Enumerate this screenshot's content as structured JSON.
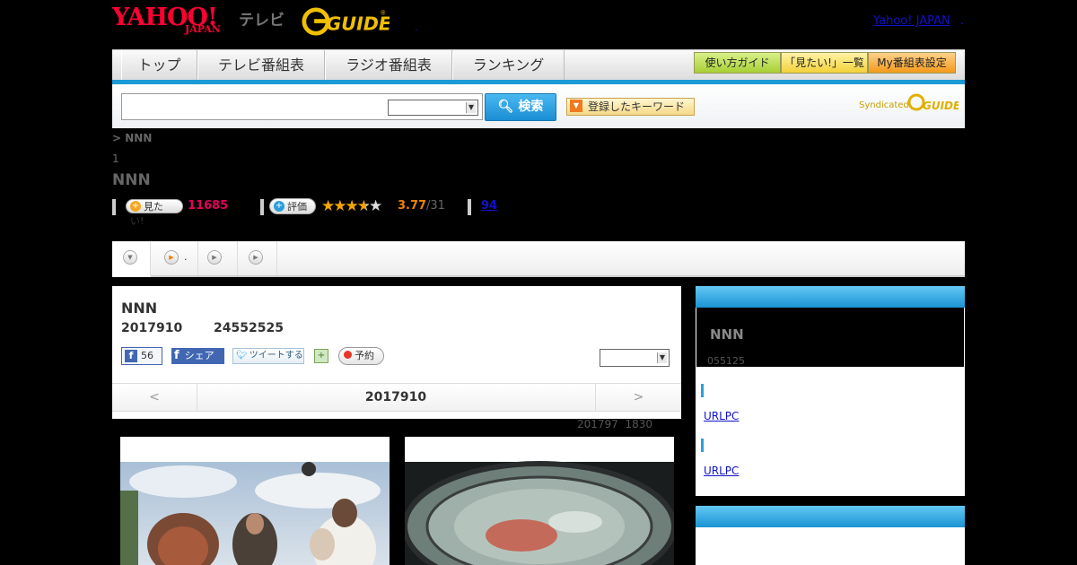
{
  "header": {
    "yahoo": "YAHOO!",
    "japan": "JAPAN",
    "tv": "テレビ",
    "gguide": "G GUIDE",
    "yahoo_japan_link": "Yahoo! JAPAN",
    "dot1": ".",
    "dot2": "."
  },
  "nav": {
    "items": [
      "トップ",
      "テレビ番組表",
      "ラジオ番組表",
      "ランキング"
    ],
    "sub_buttons": [
      "使い方ガイド",
      "「見たい!」一覧",
      "My番組表設定"
    ]
  },
  "search": {
    "button_label": "検索",
    "keyword_button": "登録したキーワード",
    "syndicated": "Syndicated",
    "g_logo": "GUIDE"
  },
  "program": {
    "breadcrumb": "> NNN",
    "ep_num": "1",
    "title": "NNN",
    "want_label": "見たい!",
    "want_count": "11685",
    "rating_label": "評価",
    "rating": "3.77",
    "rating_count": "/31",
    "reviews": "94",
    "stars_full": 3.77
  },
  "tabs": [
    {
      "icon": "down-circle-icon",
      "label": ""
    },
    {
      "icon": "play-circle-icon",
      "label": "."
    },
    {
      "icon": "play-circle-icon",
      "label": ""
    },
    {
      "icon": "play-circle-icon",
      "label": ""
    }
  ],
  "card": {
    "title": "NNN",
    "date": "2017910",
    "time": "24552525",
    "fb_like_count": "56",
    "fb_share": "シェア",
    "tweet": "ツイートする",
    "reserve": "予約",
    "pager_prev": "<",
    "pager_date": "2017910",
    "pager_next": ">",
    "below_date": "201797",
    "below_time": "1830"
  },
  "right_panel": {
    "title": "NNN",
    "sub": "055125",
    "links": [
      "URLPC",
      "URLPC"
    ]
  },
  "colors": {
    "accent_blue": "#1a9ad6",
    "pink_count": "#e6005c",
    "rating_orange": "#f08300"
  }
}
